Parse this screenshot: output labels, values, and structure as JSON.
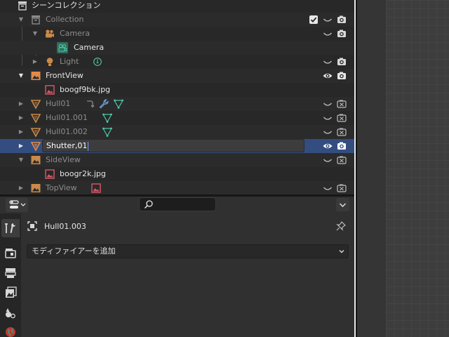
{
  "outliner": {
    "rows": [
      {
        "label": "シーンコレクション"
      },
      {
        "label": "Collection"
      },
      {
        "label": "Camera"
      },
      {
        "label": "Camera"
      },
      {
        "label": "Light"
      },
      {
        "label": "FrontView"
      },
      {
        "label": "boogf9bk.jpg"
      },
      {
        "label": "Hull01"
      },
      {
        "label": "Hull01.001"
      },
      {
        "label": "Hull01.002"
      },
      {
        "label": "Shutter,01"
      },
      {
        "label": "SideView"
      },
      {
        "label": "boogr2k.jpg"
      },
      {
        "label": "TopView"
      }
    ],
    "rename_value": "Shutter,01"
  },
  "properties": {
    "object_name": "Hull01.003",
    "add_modifier_label": "モディファイアーを追加",
    "tabs": [
      "tool-icon",
      "render-icon",
      "output-icon",
      "view-layer-icon",
      "scene-icon",
      "world-icon"
    ]
  },
  "colors": {
    "selection": "#334d80",
    "accent_orange": "#e08b4a",
    "camera_green": "#4ec6a4",
    "image_red": "#d8586a"
  }
}
